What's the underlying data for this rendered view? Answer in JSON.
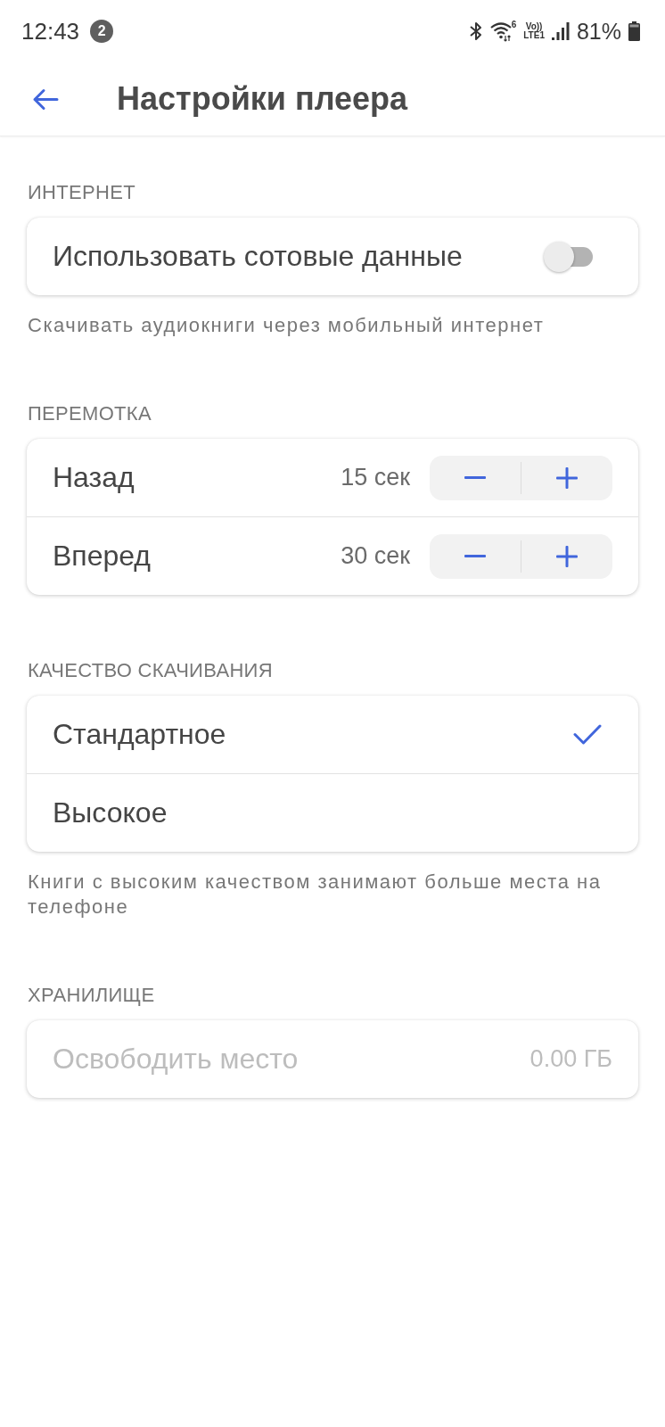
{
  "status_bar": {
    "time": "12:43",
    "notification_count": "2",
    "wifi_badge": "6",
    "volte_label": "Vo))",
    "lte_label": "LTE1",
    "battery": "81%"
  },
  "header": {
    "title": "Настройки плеера"
  },
  "sections": [
    {
      "title": "ИНТЕРНЕТ",
      "items": [
        {
          "kind": "switch",
          "label": "Использовать сотовые данные",
          "on": false
        }
      ],
      "caption": "Скачивать аудиокниги через мобильный интернет"
    },
    {
      "title": "ПЕРЕМОТКА",
      "items": [
        {
          "kind": "stepper",
          "label": "Назад",
          "value": "15 сек"
        },
        {
          "kind": "stepper",
          "label": "Вперед",
          "value": "30 сек"
        }
      ]
    },
    {
      "title": "КАЧЕСТВО СКАЧИВАНИЯ",
      "items": [
        {
          "kind": "option",
          "label": "Стандартное",
          "selected": true
        },
        {
          "kind": "option",
          "label": "Высокое",
          "selected": false
        }
      ],
      "caption": "Книги с высоким качеством занимают больше места на телефоне"
    },
    {
      "title": "ХРАНИЛИЩЕ",
      "items": [
        {
          "kind": "action",
          "label": "Освободить место",
          "value": "0.00 ГБ",
          "disabled": true
        }
      ]
    }
  ]
}
